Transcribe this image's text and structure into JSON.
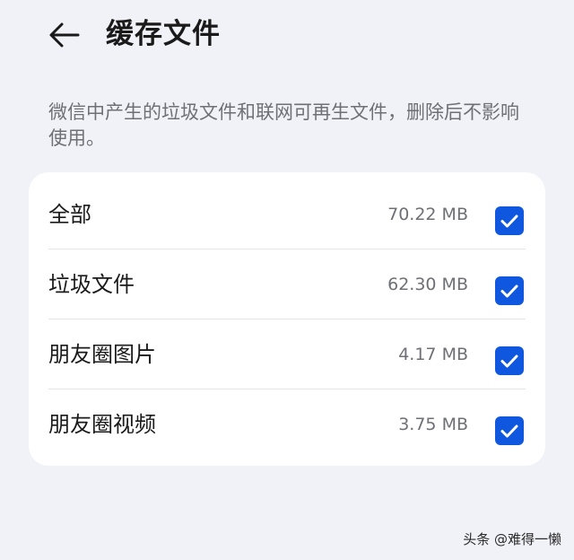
{
  "header": {
    "back_icon": "arrow-left-icon",
    "title": "缓存文件"
  },
  "description": "微信中产生的垃圾文件和联网可再生文件，删除后不影响使用。",
  "items": [
    {
      "label": "全部",
      "size": "70.22 MB",
      "checked": true
    },
    {
      "label": "垃圾文件",
      "size": "62.30 MB",
      "checked": true
    },
    {
      "label": "朋友圈图片",
      "size": "4.17 MB",
      "checked": true
    },
    {
      "label": "朋友圈视频",
      "size": "3.75 MB",
      "checked": true
    }
  ],
  "colors": {
    "background": "#f1f2f7",
    "card": "#ffffff",
    "accent": "#0f57df",
    "secondary_text": "#6f7075"
  },
  "watermark": "头条 @难得一懒"
}
